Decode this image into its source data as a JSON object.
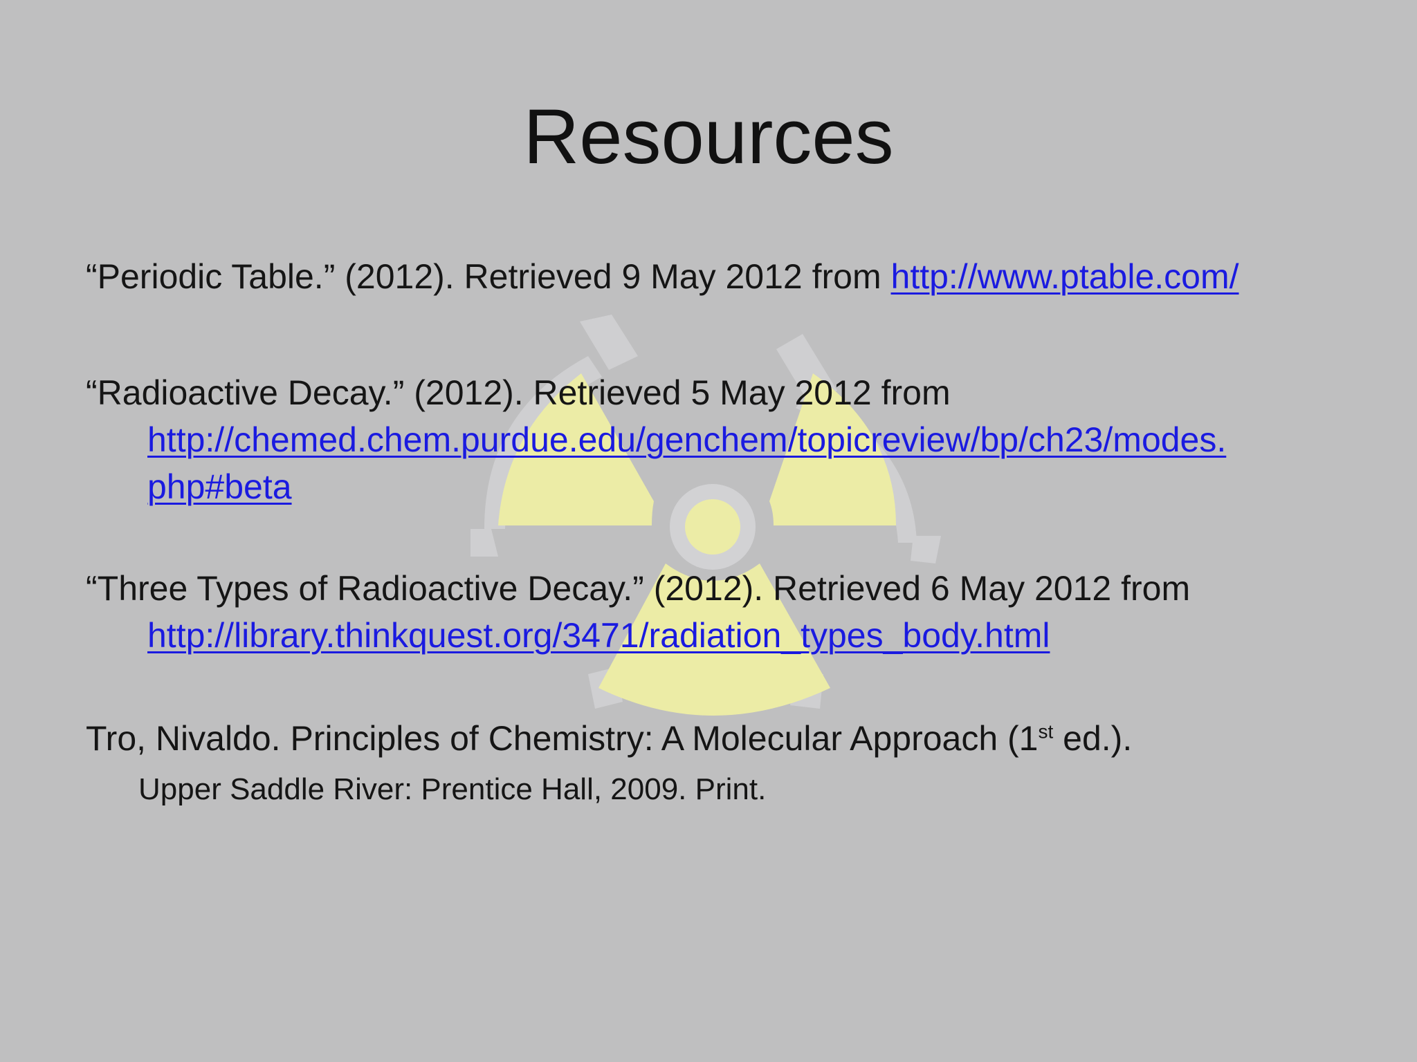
{
  "slide": {
    "title": "Resources",
    "colors": {
      "background": "#bfbfc0",
      "text": "#151515",
      "link": "#1a1ae0",
      "watermark_yellow": "#ececa8",
      "watermark_ring": "#d0d0d2"
    },
    "watermark_icon": "radiation-trefoil-icon",
    "references": [
      {
        "text": "“Periodic Table.” (2012). Retrieved 9 May 2012 from ",
        "link": "http://www.ptable.com/"
      },
      {
        "text": "“Radioactive Decay.” (2012). Retrieved 5 May 2012 from",
        "link_line1": "http://chemed.chem.purdue.edu/genchem/topicreview/bp/ch23/modes.",
        "link_line2": "php#beta"
      },
      {
        "text": "“Three Types of Radioactive Decay.” (2012). Retrieved 6 May 2012 from",
        "link": "http://library.thinkquest.org/3471/radiation_types_body.html"
      },
      {
        "text_before": "Tro, Nivaldo. Principles of Chemistry: A Molecular Approach  (1",
        "superscript": "st",
        "text_after": " ed.).",
        "continuation": "Upper Saddle River: Prentice Hall, 2009. Print."
      }
    ]
  }
}
